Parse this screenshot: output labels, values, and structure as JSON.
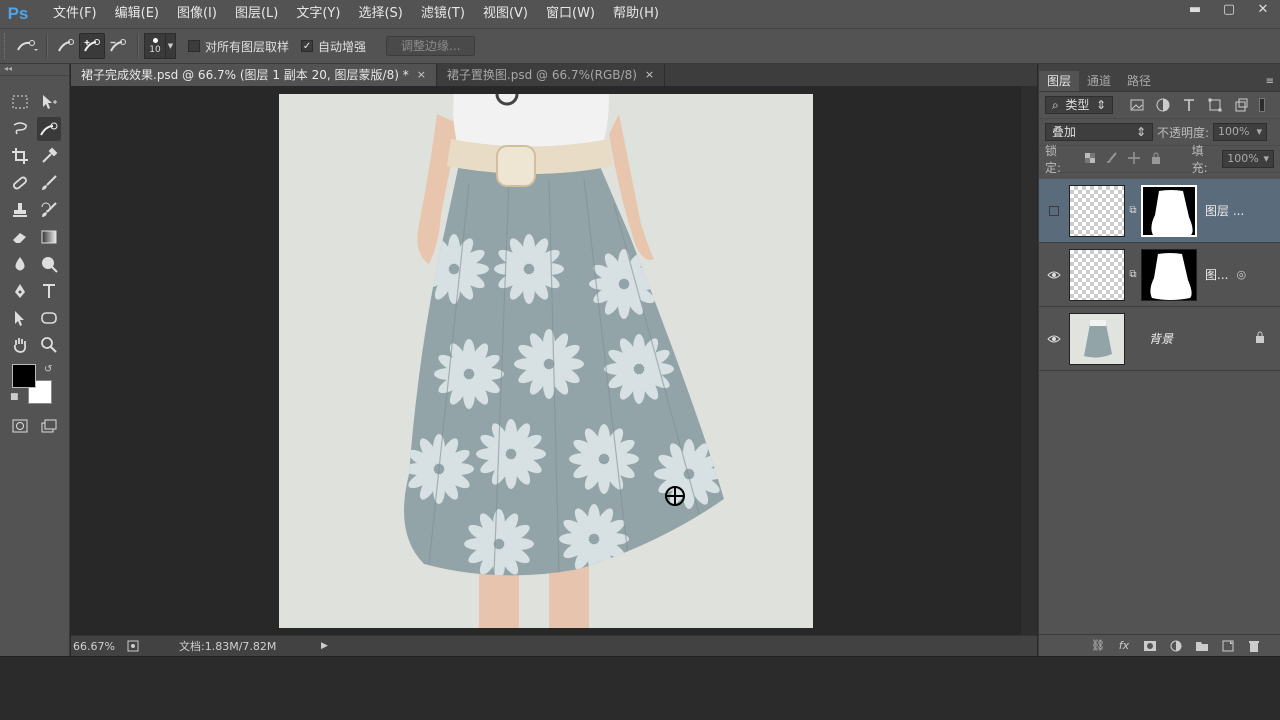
{
  "app": {
    "logo": "Ps"
  },
  "menu": [
    "文件(F)",
    "编辑(E)",
    "图像(I)",
    "图层(L)",
    "文字(Y)",
    "选择(S)",
    "滤镜(T)",
    "视图(V)",
    "窗口(W)",
    "帮助(H)"
  ],
  "window_controls": {
    "minimize": "▬",
    "maximize": "▢",
    "close": "✕"
  },
  "options": {
    "brush_size": "10",
    "sample_all_layers_label": "对所有图层取样",
    "sample_all_layers_checked": false,
    "auto_enhance_label": "自动增强",
    "auto_enhance_checked": true,
    "auto_enhance_mark": "✓",
    "refine_edge_label": "调整边缘..."
  },
  "tabs": [
    {
      "label": "裙子完成效果.psd @ 66.7% (图层 1 副本 20, 图层蒙版/8) *",
      "close": "×"
    },
    {
      "label": "裙子置换图.psd @ 66.7%(RGB/8)",
      "close": "×"
    }
  ],
  "status": {
    "zoom": "66.67%",
    "doc_size": "文档:1.83M/7.82M",
    "arrow": "▶"
  },
  "layers_panel": {
    "tabs": [
      "图层",
      "通道",
      "路径"
    ],
    "menu_icon": "≡",
    "filter_label": "类型",
    "blend_mode": "叠加",
    "opacity_label": "不透明度:",
    "opacity_value": "100%",
    "lock_label": "锁定:",
    "fill_label": "填充:",
    "fill_value": "100%",
    "layers": [
      {
        "name": "图层 ...",
        "visible": false,
        "selected": true
      },
      {
        "name": "图...",
        "visible": true,
        "selected": false
      },
      {
        "name": "背景",
        "visible": true,
        "selected": false
      }
    ]
  },
  "colors": {
    "accent": "#4ea6ea",
    "selected_layer": "#5a6b7c",
    "skirt": "#93a4a8"
  }
}
